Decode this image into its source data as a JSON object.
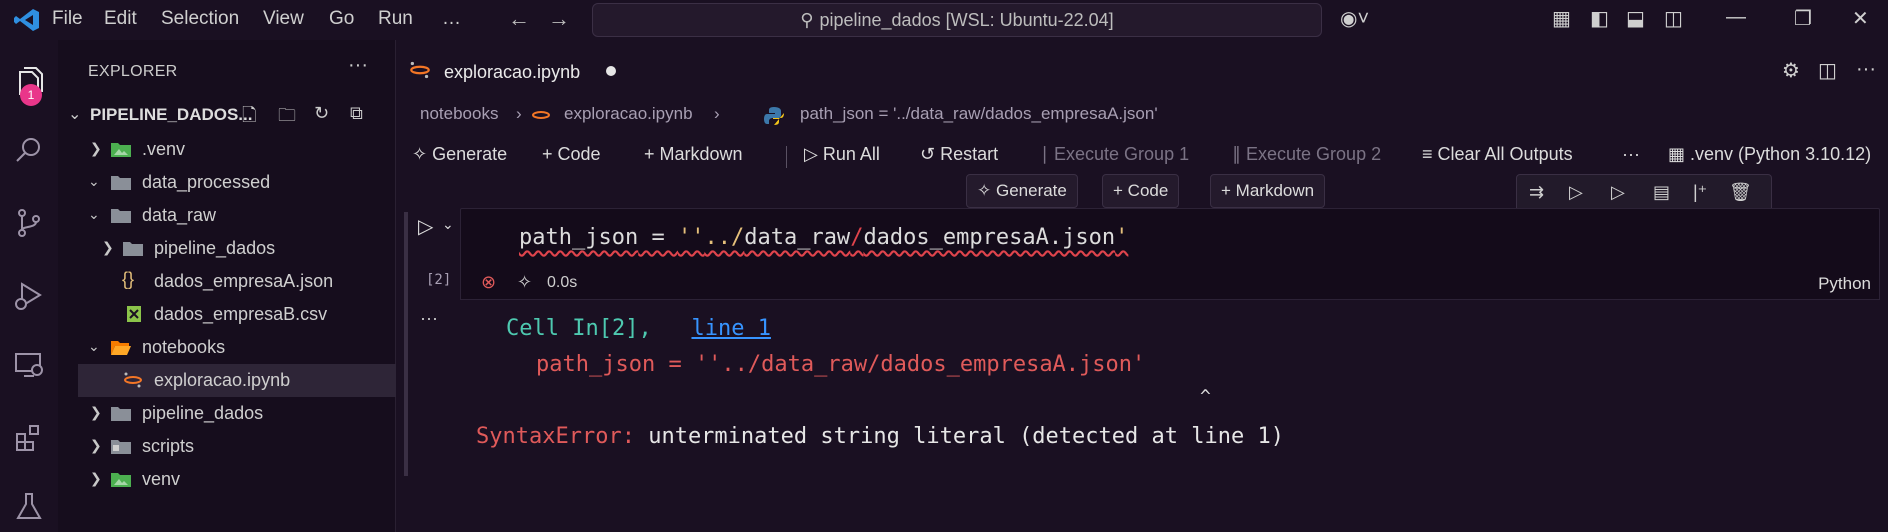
{
  "titlebar": {
    "menus": [
      "File",
      "Edit",
      "Selection",
      "View",
      "Go",
      "Run",
      "…"
    ],
    "search_text": "pipeline_dados [WSL: Ubuntu-22.04]"
  },
  "activity": {
    "explorer_badge": "1"
  },
  "explorer": {
    "title": "EXPLORER",
    "root_label": "PIPELINE_DADOS...",
    "items": [
      {
        "label": ".venv",
        "icon": "folder-env-icon",
        "expanded": false
      },
      {
        "label": "data_processed",
        "icon": "folder-icon",
        "expanded": true
      },
      {
        "label": "data_raw",
        "icon": "folder-icon",
        "expanded": true
      },
      {
        "label": "pipeline_dados",
        "icon": "folder-icon",
        "expanded": false
      },
      {
        "label": "dados_empresaA.json",
        "icon": "json-file-icon"
      },
      {
        "label": "dados_empresaB.csv",
        "icon": "csv-file-icon"
      },
      {
        "label": "notebooks",
        "icon": "folder-open-icon",
        "expanded": true
      },
      {
        "label": "exploracao.ipynb",
        "icon": "jupyter-file-icon",
        "selected": true
      },
      {
        "label": "pipeline_dados",
        "icon": "folder-icon",
        "expanded": false
      },
      {
        "label": "scripts",
        "icon": "folder-scripts-icon",
        "expanded": false
      },
      {
        "label": "venv",
        "icon": "folder-env-icon",
        "expanded": false
      }
    ]
  },
  "tab": {
    "label": "exploracao.ipynb"
  },
  "breadcrumb": {
    "folder": "notebooks",
    "file": "exploracao.ipynb",
    "symbol": "path_json = '../data_raw/dados_empresaA.json'"
  },
  "toolbar": {
    "generate": "Generate",
    "code": "Code",
    "markdown": "Markdown",
    "run_all": "Run All",
    "restart": "Restart",
    "execute_group_1": "Execute Group 1",
    "execute_group_2": "Execute Group 2",
    "clear_outputs": "Clear All Outputs",
    "kernel": ".venv (Python 3.10.12)"
  },
  "insert": {
    "generate": "Generate",
    "code": "Code",
    "markdown": "Markdown"
  },
  "cell": {
    "execution_count": "[2]",
    "code": {
      "var": "path_json",
      "op": " = ",
      "quote_open": "''",
      "p1": "../",
      "p2": "data_raw",
      "p3": "/",
      "p4": "dados_empresaA.json",
      "quote_close": "'"
    },
    "duration": "0.0s",
    "language": "Python"
  },
  "output": {
    "cell_word": "Cell",
    "in_ref": "In[2],",
    "line_link": "line 1",
    "code_line": "path_json = ''../data_raw/dados_empresaA.json'",
    "caret": "^",
    "error_name": "SyntaxError:",
    "error_msg": "unterminated string literal (detected at line 1)"
  },
  "colors": {
    "accent": "#e9368a",
    "error": "#e05a5a",
    "string_yellow": "#e5c07b",
    "ansi_green": "#4ec9b0"
  }
}
